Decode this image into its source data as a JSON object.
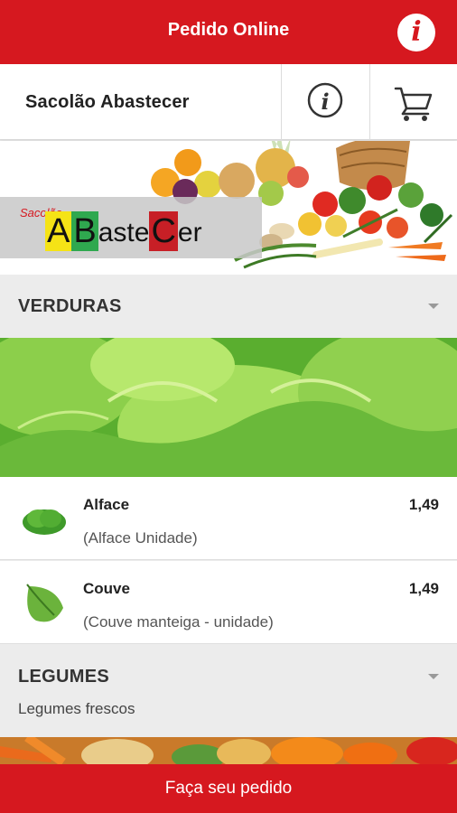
{
  "header": {
    "title": "Pedido Online",
    "info_icon": "info-icon",
    "accent_color": "#d6181f"
  },
  "store": {
    "name": "Sacolão Abastecer",
    "about_icon": "info-circle-icon",
    "cart_icon": "shopping-cart-icon"
  },
  "banner": {
    "logo_small": "Sacolão",
    "logo_letters": [
      "A",
      "B",
      "aste",
      "C",
      "er"
    ],
    "logo_colors": [
      "#f5e316",
      "#2fa84f",
      "#c71f26"
    ]
  },
  "sections": [
    {
      "title": "VERDURAS",
      "items": [
        {
          "name": "Alface",
          "description": "(Alface Unidade)",
          "price": "1,49",
          "icon": "lettuce-icon"
        },
        {
          "name": "Couve",
          "description": "(Couve manteiga - unidade)",
          "price": "1,49",
          "icon": "kale-leaf-icon"
        }
      ]
    },
    {
      "title": "LEGUMES",
      "subtitle": "Legumes frescos"
    }
  ],
  "footer": {
    "order_label": "Faça seu pedido"
  }
}
